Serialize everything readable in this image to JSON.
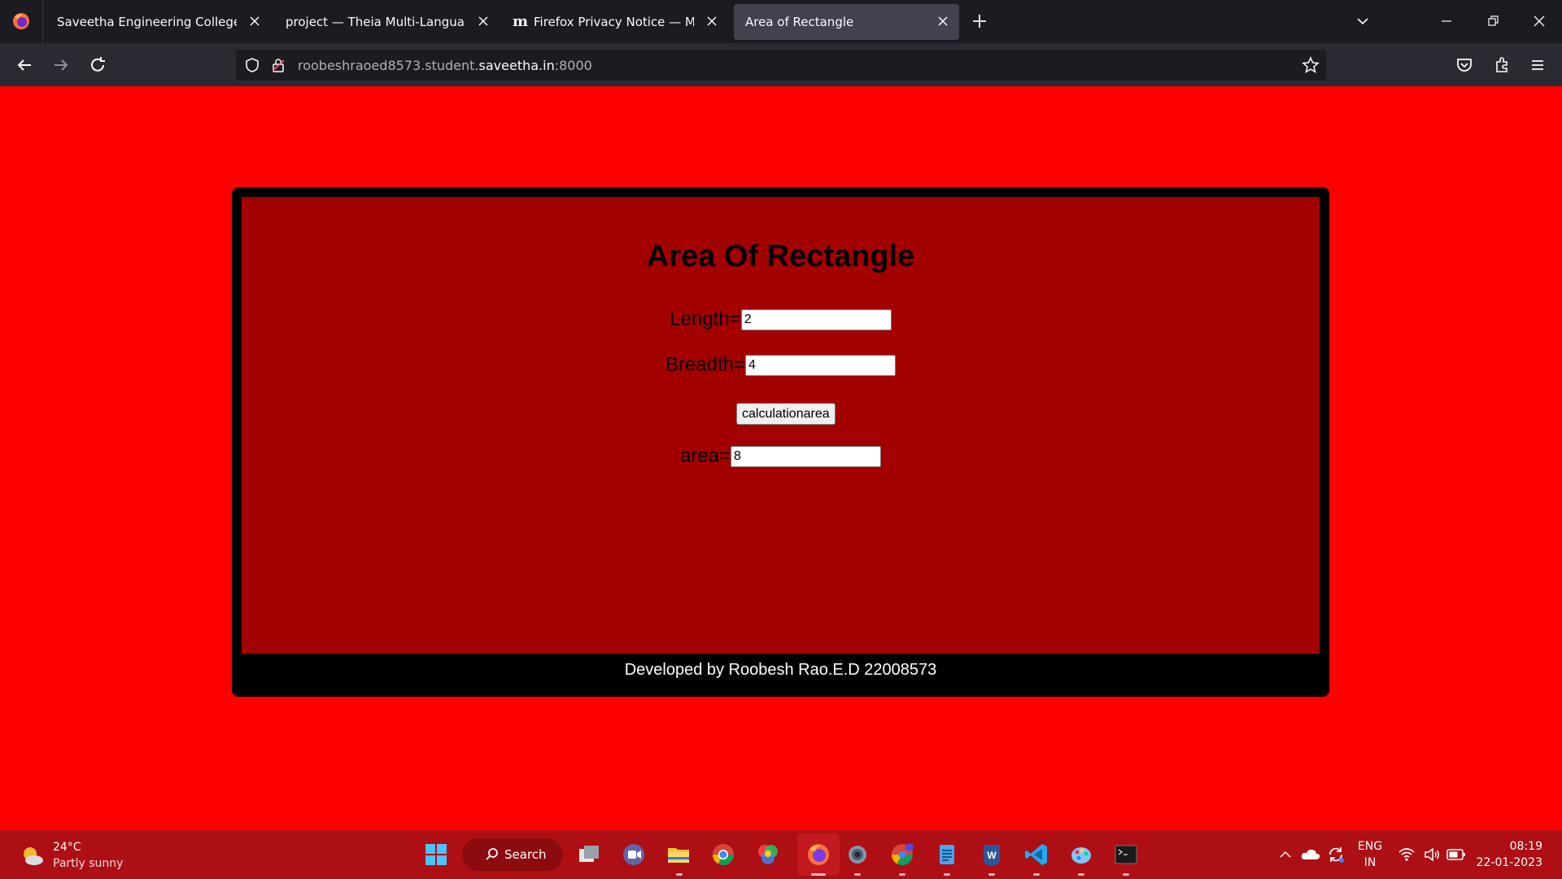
{
  "browser": {
    "tabs": [
      {
        "title": "Saveetha Engineering College",
        "active": false
      },
      {
        "title": "project — Theia Multi-Language Ex",
        "active": false
      },
      {
        "title": "Firefox Privacy Notice — Mozill",
        "active": false
      },
      {
        "title": "Area of Rectangle",
        "active": true
      }
    ],
    "url": {
      "subdomain": "roobeshraoed8573.student.",
      "host": "saveetha.in",
      "port": ":8000"
    }
  },
  "page": {
    "title": "Area Of Rectangle",
    "length_label": "Length=",
    "length_value": "2",
    "breadth_label": "Breadth=",
    "breadth_value": "4",
    "calc_button": "calculationarea",
    "area_label": "area=",
    "area_value": "8",
    "footer": "Developed by Roobesh Rao.E.D 22008573",
    "colors": {
      "background": "#ff0000",
      "panel": "#a30000",
      "frame": "#000000"
    }
  },
  "taskbar": {
    "weather": {
      "temp": "24°C",
      "condition": "Partly sunny"
    },
    "search_label": "Search",
    "language": {
      "line1": "ENG",
      "line2": "IN"
    },
    "clock": {
      "time": "08:19",
      "date": "22-01-2023"
    },
    "pinned_icons": [
      "windows-start-icon",
      "task-view-icon",
      "teams-chat-icon",
      "file-explorer-icon",
      "chrome-icon",
      "color-app-icon",
      "firefox-icon",
      "settings-icon",
      "chrome-profile-icon",
      "notepad-icon",
      "word-icon",
      "vscode-icon",
      "paint-icon",
      "terminal-icon"
    ]
  }
}
